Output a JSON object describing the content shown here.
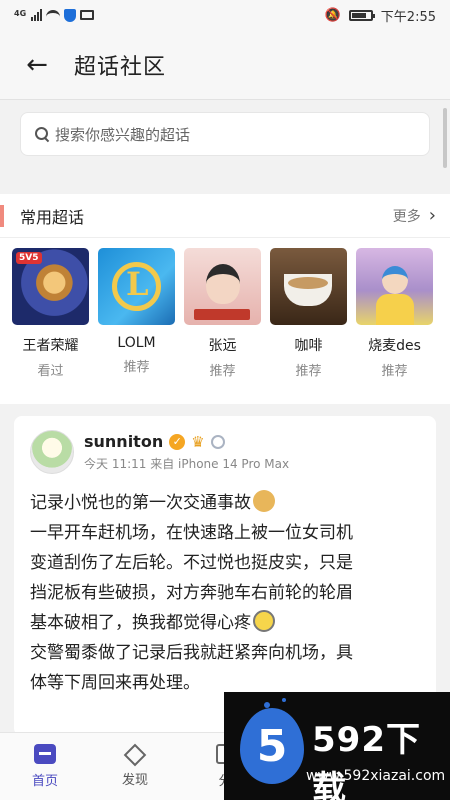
{
  "status_bar": {
    "network": "4G",
    "time": "下午2:55"
  },
  "header": {
    "back_icon": "back-arrow-icon",
    "title": "超话社区"
  },
  "search": {
    "placeholder": "搜索你感兴趣的超话"
  },
  "common_topics": {
    "title": "常用超话",
    "more_label": "更多",
    "items": [
      {
        "name": "王者荣耀",
        "status": "看过",
        "thumb_badge": "5V5"
      },
      {
        "name": "LOLM",
        "status": "推荐"
      },
      {
        "name": "张远",
        "status": "推荐"
      },
      {
        "name": "咖啡",
        "status": "推荐"
      },
      {
        "name": "烧麦des",
        "status": "推荐"
      }
    ]
  },
  "post": {
    "author": "sunniton",
    "meta": "今天 11:11  来自 iPhone 14 Pro Max",
    "lines": [
      "记录小悦也的第一次交通事故",
      "一早开车赶机场，在快速路上被一位女司机",
      "变道刮伤了左后轮。不过悦也挺皮实，只是",
      "挡泥板有些破损，对方奔驰车右前轮的轮眉",
      "基本破相了，换我都觉得心疼",
      "交警蜀黍做了记录后我就赶紧奔向机场，具",
      "体等下周回来再处理。"
    ]
  },
  "tabs": [
    {
      "label": "首页",
      "icon": "home-icon"
    },
    {
      "label": "发现",
      "icon": "discover-icon"
    },
    {
      "label": "分",
      "icon": "share-icon"
    }
  ],
  "watermark": {
    "badge": "5",
    "title": "592下载",
    "url": "www.592xiazai.com"
  },
  "colors": {
    "accent": "#4a4ac0",
    "section_bar": "#f08a7e",
    "watermark_blue": "#2f6fd6"
  }
}
